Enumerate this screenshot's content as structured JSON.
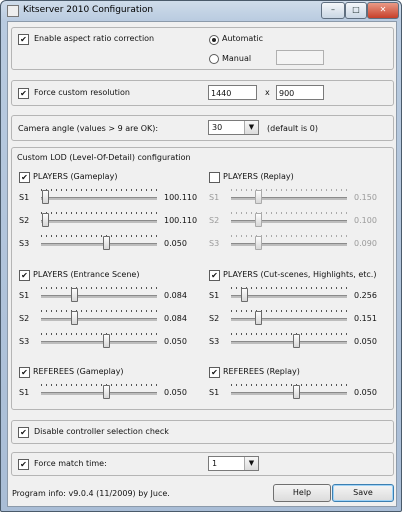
{
  "window": {
    "title": "Kitserver 2010 Configuration",
    "minimize_icon": "minimize-icon",
    "maximize_icon": "maximize-icon",
    "close_icon": "close-icon"
  },
  "aspect": {
    "label": "Enable aspect ratio correction",
    "checked": true,
    "automatic_label": "Automatic",
    "manual_label": "Manual",
    "selected": "automatic",
    "manual_value": ""
  },
  "resolution": {
    "label": "Force custom resolution",
    "checked": true,
    "width": "1440",
    "separator": "x",
    "height": "900"
  },
  "camera": {
    "label": "Camera angle (values > 9 are OK):",
    "value": "30",
    "hint": "(default is 0)"
  },
  "lod": {
    "title": "Custom LOD (Level-Of-Detail) configuration",
    "groups": [
      {
        "label": "PLAYERS (Gameplay)",
        "checked": true,
        "enabled": true,
        "rows": [
          {
            "name": "S1",
            "value": "100.110"
          },
          {
            "name": "S2",
            "value": "100.110"
          },
          {
            "name": "S3",
            "value": "0.050"
          }
        ]
      },
      {
        "label": "PLAYERS (Replay)",
        "checked": false,
        "enabled": false,
        "rows": [
          {
            "name": "S1",
            "value": "0.150"
          },
          {
            "name": "S2",
            "value": "0.100"
          },
          {
            "name": "S3",
            "value": "0.090"
          }
        ]
      },
      {
        "label": "PLAYERS (Entrance Scene)",
        "checked": true,
        "enabled": true,
        "rows": [
          {
            "name": "S1",
            "value": "0.084"
          },
          {
            "name": "S2",
            "value": "0.084"
          },
          {
            "name": "S3",
            "value": "0.050"
          }
        ]
      },
      {
        "label": "PLAYERS (Cut-scenes, Highlights, etc.)",
        "checked": true,
        "enabled": true,
        "rows": [
          {
            "name": "S1",
            "value": "0.256"
          },
          {
            "name": "S2",
            "value": "0.151"
          },
          {
            "name": "S3",
            "value": "0.050"
          }
        ]
      },
      {
        "label": "REFEREES (Gameplay)",
        "checked": true,
        "enabled": true,
        "rows": [
          {
            "name": "S1",
            "value": "0.050"
          }
        ]
      },
      {
        "label": "REFEREES (Replay)",
        "checked": true,
        "enabled": true,
        "rows": [
          {
            "name": "S1",
            "value": "0.050"
          }
        ]
      }
    ]
  },
  "controller": {
    "label": "Disable controller selection check",
    "checked": true
  },
  "match_time": {
    "label": "Force match time:",
    "checked": true,
    "value": "1"
  },
  "footer": {
    "program_info": "Program info: v9.0.4 (11/2009) by Juce.",
    "help_label": "Help",
    "save_label": "Save"
  },
  "colors": {
    "titlebar": "#b9cbe0",
    "client": "#f0f0f0",
    "close_button": "#c7402a",
    "disabled_text": "#9a9a9a"
  }
}
